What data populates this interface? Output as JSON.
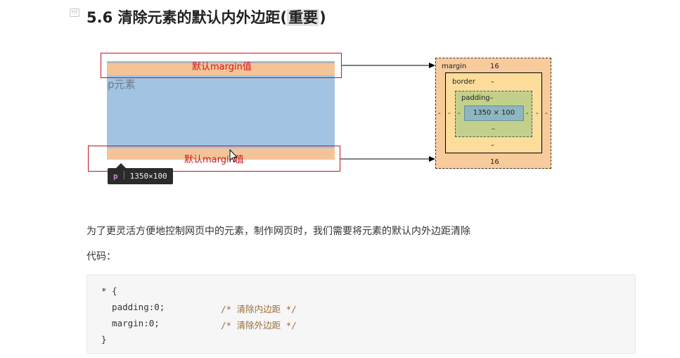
{
  "heading": {
    "badge": "H3",
    "main": "5.6 清除元素的默认内外边距(",
    "highlight": "重要",
    "tail": ")"
  },
  "illustration": {
    "margin_top_label": "默认margin值",
    "margin_bottom_label": "默认margin值",
    "element_label": "p元素",
    "tooltip": {
      "tag": "p",
      "size": "1350×100"
    },
    "box_model": {
      "margin_label": "margin",
      "margin_top": "16",
      "margin_bottom": "16",
      "margin_left": "-",
      "margin_right": "-",
      "border_label": "border",
      "border_top": "–",
      "border_bottom": "–",
      "border_left": "-",
      "border_right": "-",
      "padding_label": "padding–",
      "padding_bottom": "–",
      "padding_left": "-",
      "padding_right": "-",
      "content": "1350 × 100"
    }
  },
  "paragraph": "为了更灵活方便地控制网页中的元素，制作网页时，我们需要将元素的默认内外边距清除",
  "code_label": "代码：",
  "code": {
    "open": "* {",
    "line1": "  padding:0;",
    "comment1": "/* 清除内边距 */",
    "line2": "  margin:0;",
    "comment2": "/* 清除外边距 */",
    "close": "}"
  }
}
